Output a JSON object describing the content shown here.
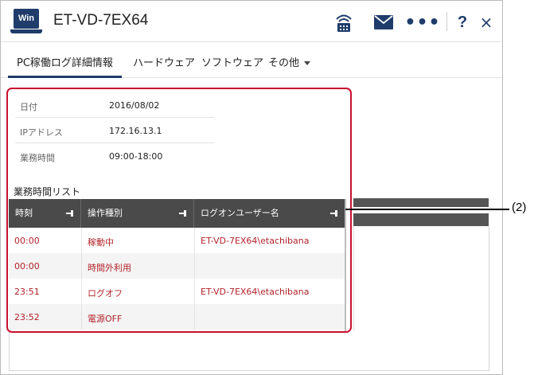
{
  "titlebar": {
    "os_badge": "Win",
    "device_name": "ET-VD-7EX64",
    "icons": [
      "network-icon",
      "mail-icon",
      "more-icon",
      "help-icon",
      "close-icon"
    ],
    "more_glyph": "•••",
    "help_glyph": "?",
    "close_glyph": "×"
  },
  "tabs": [
    {
      "label": "PC稼働ログ詳細情報",
      "active": true
    },
    {
      "label": "ハードウェア",
      "active": false
    },
    {
      "label": "ソフトウェア",
      "active": false
    },
    {
      "label": "その他",
      "active": false,
      "dropdown": true
    }
  ],
  "info": {
    "date_label": "日付",
    "date_value": "2016/08/02",
    "ip_label": "IPアドレス",
    "ip_value": "172.16.13.1",
    "hours_label": "業務時間",
    "hours_value": "09:00-18:00"
  },
  "list": {
    "title": "業務時間リスト",
    "columns": [
      "時刻",
      "操作種別",
      "ログオンユーザー名"
    ],
    "rows": [
      {
        "time": "00:00",
        "op": "稼動中",
        "user": "ET-VD-7EX64\\etachibana"
      },
      {
        "time": "00:00",
        "op": "時間外利用",
        "user": ""
      },
      {
        "time": "23:51",
        "op": "ログオフ",
        "user": "ET-VD-7EX64\\etachibana"
      },
      {
        "time": "23:52",
        "op": "電源OFF",
        "user": ""
      }
    ]
  },
  "annotation": {
    "label": "(2)",
    "color": "#c8102e"
  },
  "colors": {
    "brand": "#1f3c6b",
    "row_text": "#b2232a",
    "grid_header": "#4a4a4a"
  }
}
